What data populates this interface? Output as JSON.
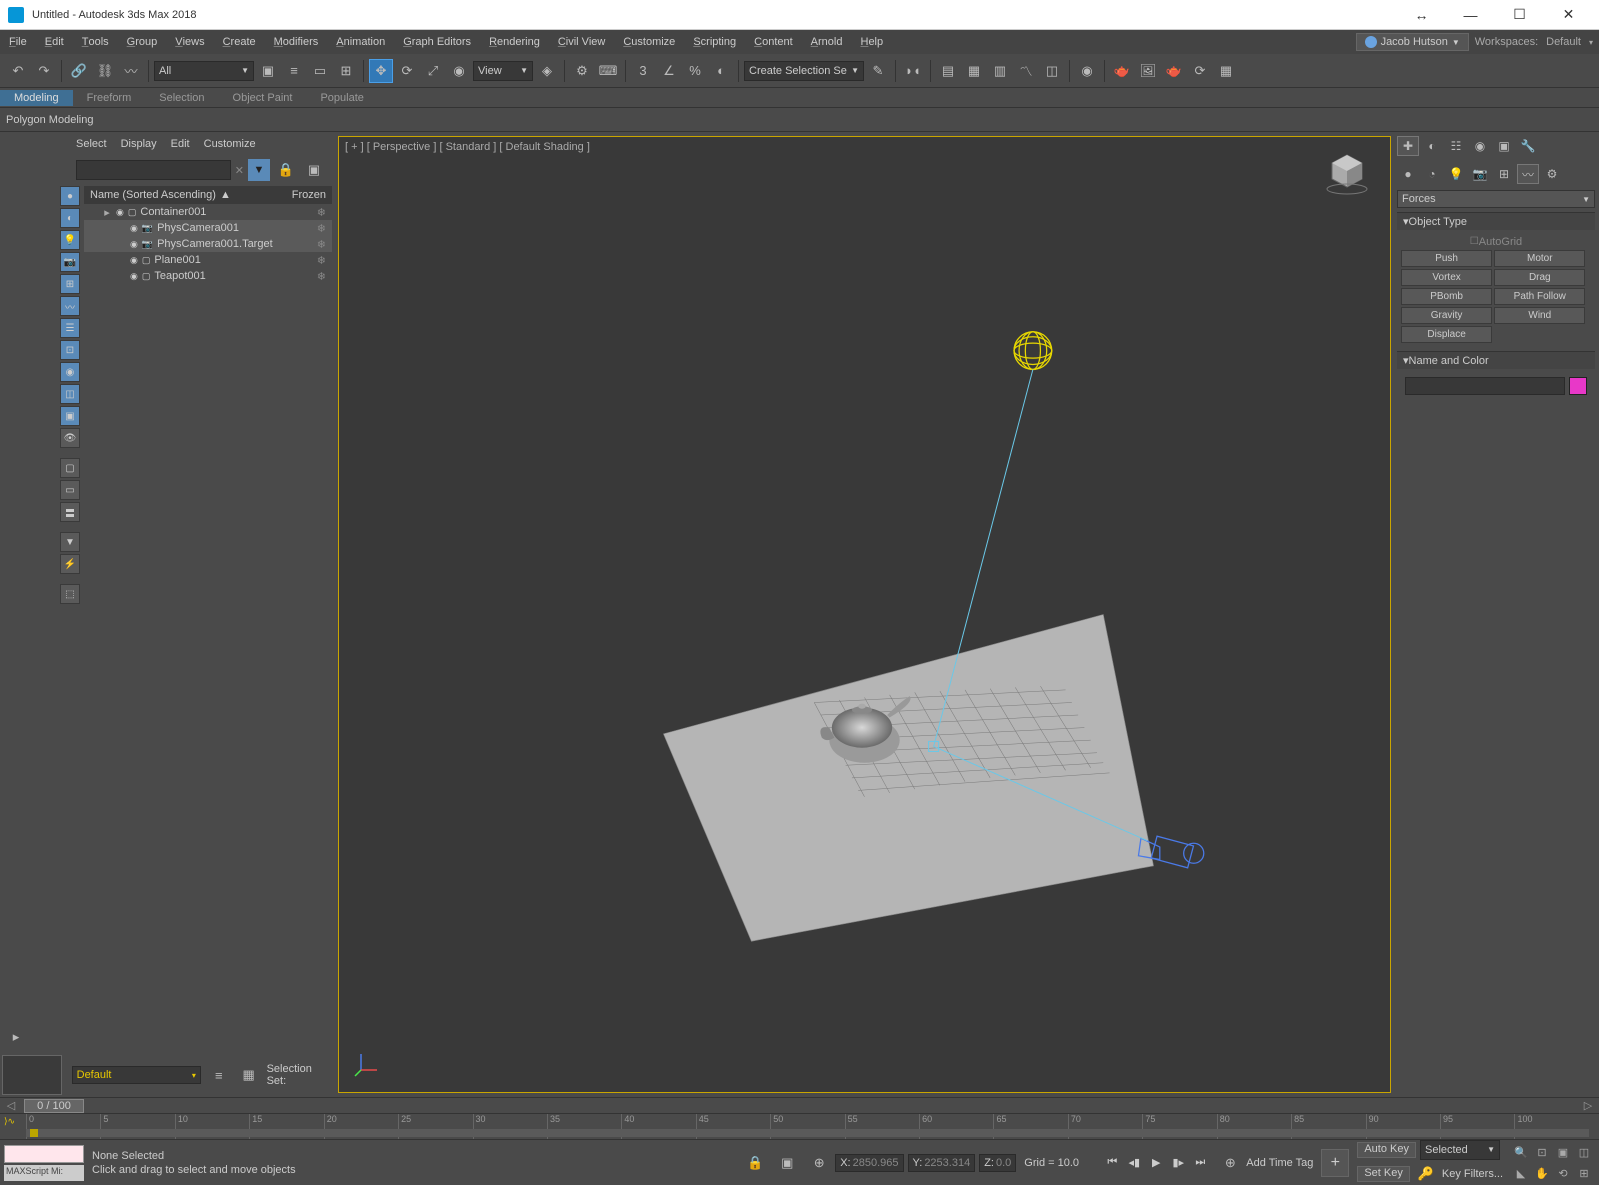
{
  "title": "Untitled - Autodesk 3ds Max 2018",
  "menus": [
    "File",
    "Edit",
    "Tools",
    "Group",
    "Views",
    "Create",
    "Modifiers",
    "Animation",
    "Graph Editors",
    "Rendering",
    "Civil View",
    "Customize",
    "Scripting",
    "Content",
    "Arnold",
    "Help"
  ],
  "user": "Jacob Hutson",
  "workspaces_label": "Workspaces:",
  "workspaces_value": "Default",
  "toolbar_all": "All",
  "toolbar_view": "View",
  "selection_set_dd": "Create Selection Se",
  "ribbon_tabs": [
    "Modeling",
    "Freeform",
    "Selection",
    "Object Paint",
    "Populate"
  ],
  "polygon_modeling": "Polygon Modeling",
  "se_tabs": [
    "Select",
    "Display",
    "Edit",
    "Customize"
  ],
  "se_header": "Name (Sorted Ascending)",
  "se_frozen": "Frozen",
  "scene_items": [
    {
      "name": "Container001",
      "indent": 0,
      "expandable": true,
      "sel": false
    },
    {
      "name": "PhysCamera001",
      "indent": 1,
      "expandable": false,
      "sel": true,
      "cam": true
    },
    {
      "name": "PhysCamera001.Target",
      "indent": 1,
      "expandable": false,
      "sel": true,
      "cam": true
    },
    {
      "name": "Plane001",
      "indent": 1,
      "expandable": false,
      "sel": false
    },
    {
      "name": "Teapot001",
      "indent": 1,
      "expandable": false,
      "sel": false
    }
  ],
  "viewport_label": "[ + ] [ Perspective ] [ Standard ] [ Default Shading ]",
  "command_panel_dd": "Forces",
  "rollout_objtype": "Object Type",
  "autogrid": "AutoGrid",
  "force_buttons": [
    "Push",
    "Motor",
    "Vortex",
    "Drag",
    "PBomb",
    "Path Follow",
    "Gravity",
    "Wind",
    "Displace"
  ],
  "rollout_namecolor": "Name and Color",
  "frame_display": "0 / 100",
  "ruler_marks": [
    "0",
    "5",
    "10",
    "15",
    "20",
    "25",
    "30",
    "35",
    "40",
    "45",
    "50",
    "55",
    "60",
    "65",
    "70",
    "75",
    "80",
    "85",
    "90",
    "95",
    "100"
  ],
  "layer_default": "Default",
  "selection_set_label": "Selection Set:",
  "status_none": "None Selected",
  "status_hint": "Click and drag to select and move objects",
  "maxscript": "MAXScript Mi:",
  "coord_x": "2850.965",
  "coord_y": "2253.314",
  "coord_z": "0.0",
  "grid": "Grid = 10.0",
  "add_time_tag": "Add Time Tag",
  "auto_key": "Auto Key",
  "set_key": "Set Key",
  "selected": "Selected",
  "key_filters": "Key Filters..."
}
